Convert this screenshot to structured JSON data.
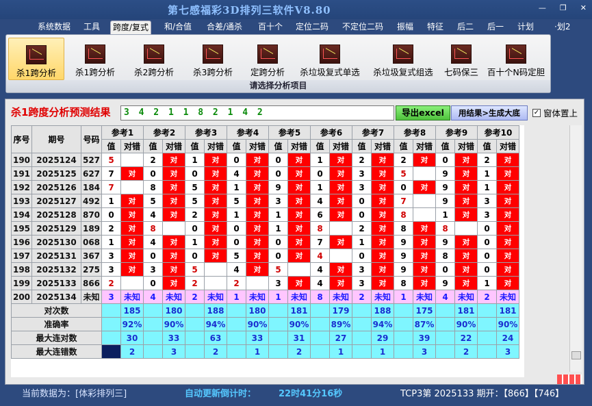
{
  "window": {
    "title": "第七感福彩3D排列三软件V8.80",
    "controls": [
      "—",
      "❐",
      "✕"
    ]
  },
  "menu": [
    "系统数据",
    "工具",
    "跨度/复式",
    "和/合值",
    "合差/通杀",
    "百十个",
    "定位二码",
    "不定位二码",
    "振幅",
    "特征",
    "后二",
    "后一",
    "计划",
    "·划2"
  ],
  "ribbon": {
    "items": [
      "杀1跨分析",
      "杀1跨分析",
      "杀2跨分析",
      "杀3跨分析",
      "定跨分析",
      "杀垃圾复式单选",
      "杀垃圾复式组选",
      "七码保三",
      "百十个N码定胆"
    ],
    "caption": "请选择分析项目"
  },
  "result": {
    "title": "杀1跨度分析预测结果",
    "value": "3 4 2 1 1 8 2 1 4 2",
    "excel_label": "导出excel",
    "gen_label": "用结果>生成大底",
    "pin_label": "窗体置上",
    "pin_mark": "✓"
  },
  "table": {
    "h_seq": "序号",
    "h_issue": "期号",
    "h_num": "号码",
    "ref_headers": [
      "参考1",
      "参考2",
      "参考3",
      "参考4",
      "参考5",
      "参考6",
      "参考7",
      "参考8",
      "参考9",
      "参考10"
    ],
    "sub_val": "值",
    "sub_ok": "对错",
    "hit": "对",
    "rows": [
      {
        "seq": "190",
        "issue": "2025124",
        "num": "527",
        "vals": [
          "5",
          "2",
          "1",
          "0",
          "0",
          "1",
          "2",
          "2",
          "0",
          "2"
        ],
        "flags": [
          0,
          1,
          1,
          1,
          1,
          1,
          1,
          1,
          1,
          1
        ]
      },
      {
        "seq": "191",
        "issue": "2025125",
        "num": "627",
        "vals": [
          "7",
          "0",
          "0",
          "4",
          "0",
          "0",
          "3",
          "5",
          "9",
          "1"
        ],
        "flags": [
          1,
          1,
          1,
          1,
          1,
          1,
          1,
          0,
          1,
          1
        ]
      },
      {
        "seq": "192",
        "issue": "2025126",
        "num": "184",
        "vals": [
          "7",
          "8",
          "5",
          "1",
          "9",
          "1",
          "3",
          "0",
          "9",
          "1"
        ],
        "flags": [
          0,
          1,
          1,
          1,
          1,
          1,
          1,
          1,
          1,
          1
        ]
      },
      {
        "seq": "193",
        "issue": "2025127",
        "num": "492",
        "vals": [
          "1",
          "5",
          "5",
          "5",
          "3",
          "4",
          "0",
          "7",
          "9",
          "3"
        ],
        "flags": [
          1,
          1,
          1,
          1,
          1,
          1,
          1,
          0,
          1,
          1
        ]
      },
      {
        "seq": "194",
        "issue": "2025128",
        "num": "870",
        "vals": [
          "0",
          "4",
          "2",
          "1",
          "1",
          "6",
          "0",
          "8",
          "1",
          "3"
        ],
        "flags": [
          1,
          1,
          1,
          1,
          1,
          1,
          1,
          0,
          1,
          1
        ]
      },
      {
        "seq": "195",
        "issue": "2025129",
        "num": "189",
        "vals": [
          "2",
          "8",
          "0",
          "0",
          "1",
          "8",
          "2",
          "8",
          "8",
          "0"
        ],
        "flags": [
          1,
          0,
          1,
          1,
          1,
          0,
          1,
          1,
          0,
          1
        ]
      },
      {
        "seq": "196",
        "issue": "2025130",
        "num": "068",
        "vals": [
          "1",
          "4",
          "1",
          "0",
          "0",
          "7",
          "1",
          "9",
          "9",
          "0"
        ],
        "flags": [
          1,
          1,
          1,
          1,
          1,
          1,
          1,
          1,
          1,
          1
        ]
      },
      {
        "seq": "197",
        "issue": "2025131",
        "num": "367",
        "vals": [
          "3",
          "0",
          "0",
          "5",
          "0",
          "4",
          "0",
          "9",
          "8",
          "0"
        ],
        "flags": [
          1,
          1,
          1,
          1,
          1,
          0,
          1,
          1,
          1,
          1
        ]
      },
      {
        "seq": "198",
        "issue": "2025132",
        "num": "275",
        "vals": [
          "3",
          "3",
          "5",
          "4",
          "5",
          "4",
          "3",
          "9",
          "0",
          "0"
        ],
        "flags": [
          1,
          1,
          0,
          1,
          0,
          1,
          1,
          1,
          1,
          1
        ]
      },
      {
        "seq": "199",
        "issue": "2025133",
        "num": "866",
        "vals": [
          "2",
          "0",
          "2",
          "2",
          "3",
          "4",
          "3",
          "8",
          "9",
          "1"
        ],
        "flags": [
          0,
          1,
          0,
          0,
          1,
          1,
          1,
          1,
          1,
          1
        ]
      }
    ],
    "pred_row": {
      "seq": "200",
      "issue": "2025134",
      "num": "未知",
      "vals": [
        "3",
        "4",
        "2",
        "1",
        "1",
        "8",
        "2",
        "1",
        "4",
        "2"
      ],
      "mark": "未知"
    },
    "stats": [
      {
        "label": "对次数",
        "vals": [
          "185",
          "180",
          "188",
          "180",
          "181",
          "179",
          "188",
          "175",
          "181",
          "181"
        ]
      },
      {
        "label": "准确率",
        "vals": [
          "92%",
          "90%",
          "94%",
          "90%",
          "90%",
          "89%",
          "94%",
          "87%",
          "90%",
          "90%"
        ]
      },
      {
        "label": "最大连对数",
        "vals": [
          "30",
          "33",
          "63",
          "33",
          "31",
          "27",
          "29",
          "39",
          "22",
          "24"
        ]
      },
      {
        "label": "最大连错数",
        "vals": [
          "2",
          "3",
          "2",
          "1",
          "2",
          "1",
          "1",
          "3",
          "2",
          "3"
        ]
      }
    ]
  },
  "status": {
    "current": "当前数据为：[体彩排列三]",
    "countdown_label": "自动更新倒计时：",
    "countdown": "22时41分16秒",
    "draw": "TCP3第 2025133 期开：【866】【746】"
  }
}
